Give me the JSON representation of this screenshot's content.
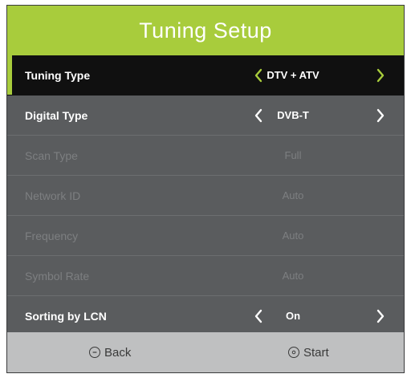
{
  "colors": {
    "accent": "#a8cc3c"
  },
  "header": {
    "title": "Tuning Setup"
  },
  "rows": [
    {
      "label": "Tuning Type",
      "value": "DTV + ATV",
      "arrows": true,
      "selected": true,
      "enabled": true
    },
    {
      "label": "Digital Type",
      "value": "DVB-T",
      "arrows": true,
      "selected": false,
      "enabled": true
    },
    {
      "label": "Scan Type",
      "value": "Full",
      "arrows": false,
      "selected": false,
      "enabled": false
    },
    {
      "label": "Network ID",
      "value": "Auto",
      "arrows": false,
      "selected": false,
      "enabled": false
    },
    {
      "label": "Frequency",
      "value": "Auto",
      "arrows": false,
      "selected": false,
      "enabled": false
    },
    {
      "label": "Symbol Rate",
      "value": "Auto",
      "arrows": false,
      "selected": false,
      "enabled": false
    },
    {
      "label": "Sorting by LCN",
      "value": "On",
      "arrows": true,
      "selected": false,
      "enabled": true
    }
  ],
  "footer": {
    "back_label": "Back",
    "back_icon": "back-key-icon",
    "start_label": "Start",
    "start_icon": "ok-key-icon"
  }
}
